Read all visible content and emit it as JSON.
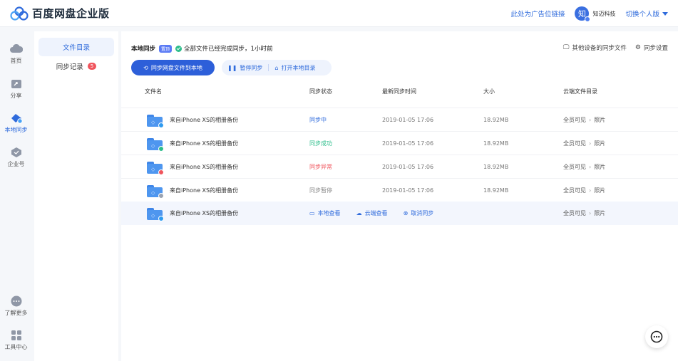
{
  "header": {
    "logo_text": "百度网盘企业版",
    "ad_link": "此处为广告位链接",
    "avatar_char": "知",
    "user_name": "知迈科技",
    "switch_label": "切换个人版"
  },
  "leftnav": {
    "items": [
      {
        "label": "首页",
        "icon": "cloud-icon"
      },
      {
        "label": "分享",
        "icon": "share-icon"
      },
      {
        "label": "本地同步",
        "icon": "sync-icon"
      },
      {
        "label": "企业号",
        "icon": "enterprise-icon"
      },
      {
        "label": "了解更多",
        "icon": "more-icon"
      },
      {
        "label": "工具中心",
        "icon": "tools-icon"
      }
    ]
  },
  "subnav": {
    "items": [
      {
        "label": "文件目录"
      },
      {
        "label": "同步记录",
        "badge": "5"
      }
    ]
  },
  "main": {
    "title": "本地同步",
    "tag": "置顶",
    "status_text": "全部文件已经完成同步，1小时前",
    "other_devices": "其他设备的同步文件",
    "settings": "同步设置",
    "primary_button": "同步网盘文件到本地",
    "pause_button": "暂停同步",
    "open_button": "打开本地目录"
  },
  "table": {
    "headers": {
      "name": "文件名",
      "status": "同步状态",
      "time": "最新同步时间",
      "size": "大小",
      "dir": "云端文件目录"
    },
    "rows": [
      {
        "name": "来自iPhone XS的相册备份",
        "status": "同步中",
        "status_kind": "syncing",
        "time": "2019-01-05 17:06",
        "size": "18.92MB",
        "dir_root": "全员可见",
        "dir_leaf": "照片"
      },
      {
        "name": "来自iPhone XS的相册备份",
        "status": "同步成功",
        "status_kind": "ok",
        "time": "2019-01-05 17:06",
        "size": "18.92MB",
        "dir_root": "全员可见",
        "dir_leaf": "照片"
      },
      {
        "name": "来自iPhone XS的相册备份",
        "status": "同步异常",
        "status_kind": "err",
        "time": "2019-01-05 17:06",
        "size": "18.92MB",
        "dir_root": "全员可见",
        "dir_leaf": "照片"
      },
      {
        "name": "来自iPhone XS的相册备份",
        "status": "同步暂停",
        "status_kind": "paused",
        "time": "2019-01-05 17:06",
        "size": "18.92MB",
        "dir_root": "全员可见",
        "dir_leaf": "照片"
      }
    ],
    "hover_row": {
      "name": "来自iPhone XS的相册备份",
      "action_local": "本地查看",
      "action_cloud": "云端查看",
      "action_cancel": "取消同步",
      "dir_root": "全员可见",
      "dir_leaf": "照片"
    }
  },
  "colors": {
    "accent": "#2f6bdc",
    "ok": "#2dbd8b",
    "error": "#f0545c",
    "paused": "#888888"
  }
}
